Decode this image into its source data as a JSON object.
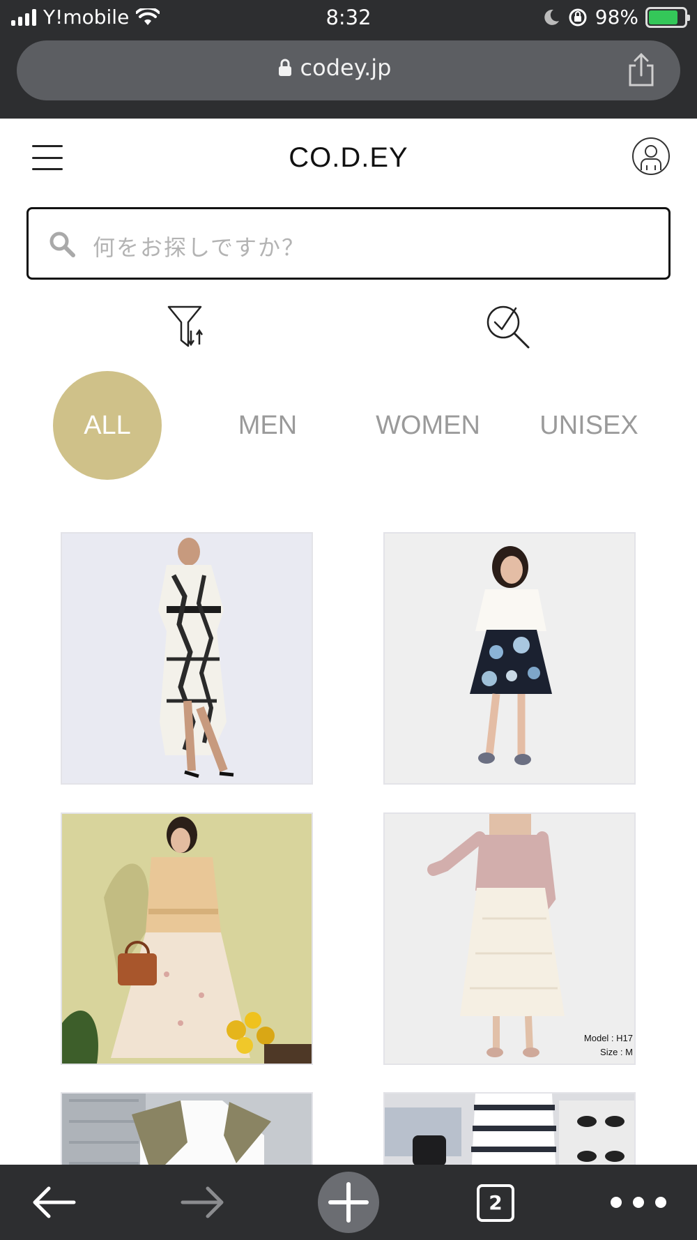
{
  "status_bar": {
    "carrier": "Y!mobile",
    "time": "8:32",
    "battery": "98%"
  },
  "browser": {
    "url": "codey.jp"
  },
  "header": {
    "brand": "CO.D.EY"
  },
  "search": {
    "placeholder": "何をお探しですか？"
  },
  "tabs": [
    {
      "label": "ALL",
      "active": true
    },
    {
      "label": "MEN",
      "active": false
    },
    {
      "label": "WOMEN",
      "active": false
    },
    {
      "label": "UNISEX",
      "active": false
    }
  ],
  "products": [
    {
      "name": "white chain print wrap dress with black belt"
    },
    {
      "name": "white knit top with navy floral skirt"
    },
    {
      "name": "beige shirt jacket with floral tulle skirt"
    },
    {
      "name": "pink cardigan with ivory lace skirt",
      "notes": [
        "Model : H17",
        "Size : M"
      ]
    },
    {
      "name": "white tee with knit vest"
    },
    {
      "name": "striped top with knit scarf"
    }
  ],
  "toolbar": {
    "tabs_count": "2"
  },
  "colors": {
    "accent": "#cfc189",
    "chrome": "#2d2e30",
    "url_bar": "#5c5e62",
    "battery_green": "#34c759"
  }
}
